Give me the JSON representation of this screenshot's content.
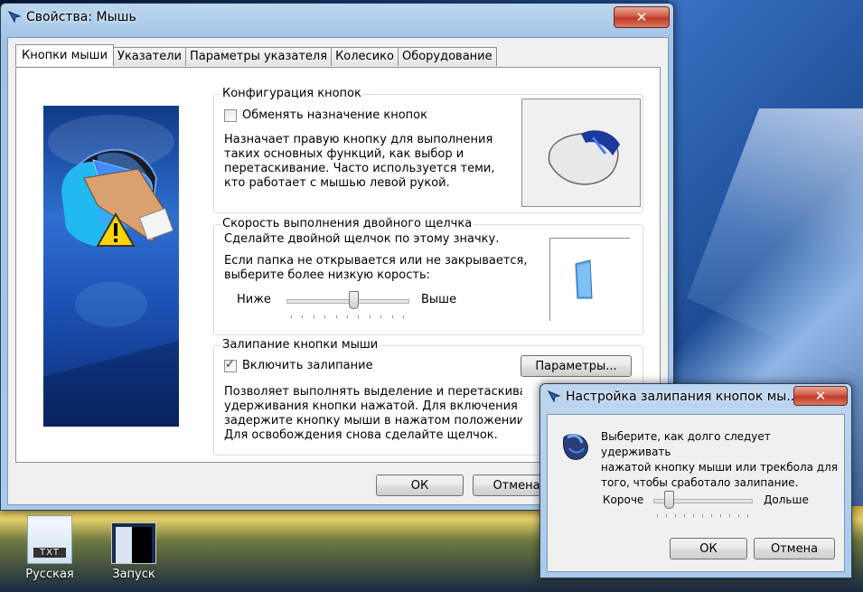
{
  "window": {
    "title": "Свойства: Мышь",
    "close_glyph": "✕",
    "tabs": [
      "Кнопки мыши",
      "Указатели",
      "Параметры указателя",
      "Колесико",
      "Оборудование"
    ],
    "buttons_config": {
      "legend": "Конфигурация кнопок",
      "swap_label": "Обменять назначение кнопок",
      "swap_checked": false,
      "desc": [
        "Назначает правую кнопку для выполнения",
        "таких основных функций, как выбор и",
        "перетаскивание. Часто используется теми,",
        "кто работает с мышью левой рукой."
      ]
    },
    "dblclick": {
      "legend": "Скорость выполнения двойного щелчка",
      "line1": "Сделайте двойной щелчок по этому значку.",
      "line2": "Если папка не открывается или не закрывается,",
      "line3": "выберите более низкую корость:",
      "slow_label": "Ниже",
      "fast_label": "Выше",
      "slider_value": 0.55
    },
    "clicklock": {
      "legend": "Залипание кнопки мыши",
      "enable_label": "Включить залипание",
      "enable_checked": true,
      "settings_button": "Параметры...",
      "desc": [
        "Позволяет выполнять выделение и перетаскивание без",
        "удерживания кнопки нажатой. Для включения ненадолго",
        "задержите кнопку мыши в нажатом положении.",
        "Для освобождения снова сделайте щелчок."
      ]
    },
    "ok_button": "ОК",
    "cancel_button": "Отмена"
  },
  "dialog": {
    "title": "Настройка залипания кнопок мы...",
    "close_glyph": "✕",
    "desc": [
      "Выберите, как долго следует удерживать",
      "нажатой кнопку мыши или трекбола для",
      "того, чтобы сработало залипание."
    ],
    "short_label": "Короче",
    "long_label": "Дольше",
    "slider_value": 0.12,
    "ok_button": "ОК",
    "cancel_button": "Отмена"
  },
  "desktop": {
    "icons": [
      {
        "label": "Русская",
        "icon": "text-file-icon",
        "badge": "TXT"
      },
      {
        "label": "Запуск",
        "icon": "screenshot-icon"
      }
    ]
  }
}
